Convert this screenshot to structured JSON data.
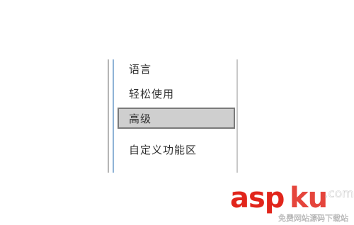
{
  "options_nav": {
    "items": [
      {
        "label": "语言",
        "selected": false
      },
      {
        "label": "轻松使用",
        "selected": false
      },
      {
        "label": "高级",
        "selected": true
      },
      {
        "label": "自定义功能区",
        "selected": false
      }
    ]
  },
  "watermark": {
    "brand": "aspku",
    "domain": ".com",
    "tagline": "免费网站源码下载站"
  },
  "colors": {
    "selected_bg": "#cfcfcf",
    "selected_border": "#7a7a7a",
    "accent_blue": "#8fb3d6",
    "watermark_red": "#e1251b"
  }
}
